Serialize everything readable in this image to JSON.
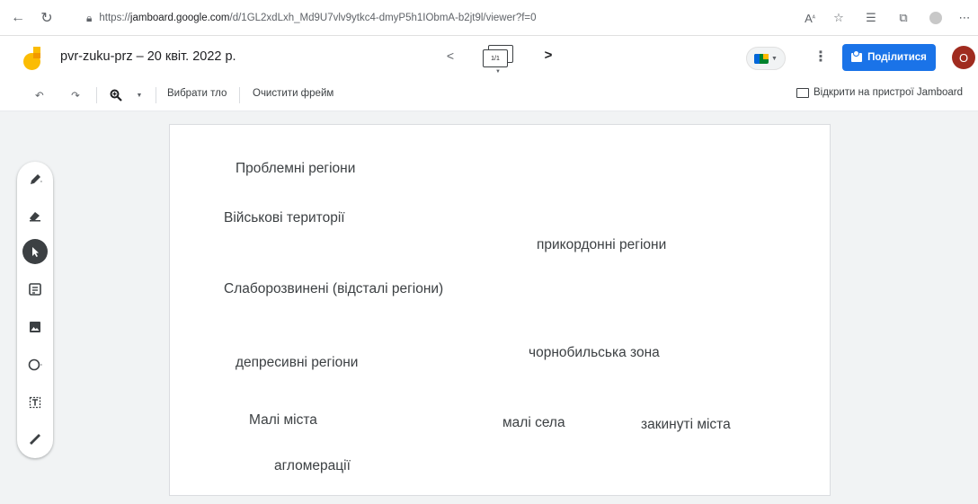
{
  "browser": {
    "url_prefix": "https://",
    "url_host": "jamboard.google.com",
    "url_path": "/d/1GL2xdLxh_Md9U7vlv9ytkc4-dmyP5h1IObmA-b2jt9l/viewer?f=0"
  },
  "header": {
    "title": "pvr-zuku-prz – 20 квіт. 2022 р.",
    "frame_counter": "1/1",
    "share_label": "Поділитися",
    "avatar_initial": "O"
  },
  "toolbar": {
    "set_background": "Вибрати тло",
    "clear_frame": "Очистити фрейм",
    "open_on_device": "Відкрити на пристрої Jamboard"
  },
  "canvas": {
    "items": [
      "Проблемні регіони",
      "Військові території",
      "прикордонні регіони",
      "Слаборозвинені (відсталі регіони)",
      "депресивні регіони",
      "чорнобильська зона",
      "Малі міста",
      "малі села",
      "закинуті міста",
      "агломерації"
    ]
  },
  "colors": {
    "primary": "#1a73e8",
    "avatar": "#a02b1f",
    "logo": "#fbbc04"
  }
}
